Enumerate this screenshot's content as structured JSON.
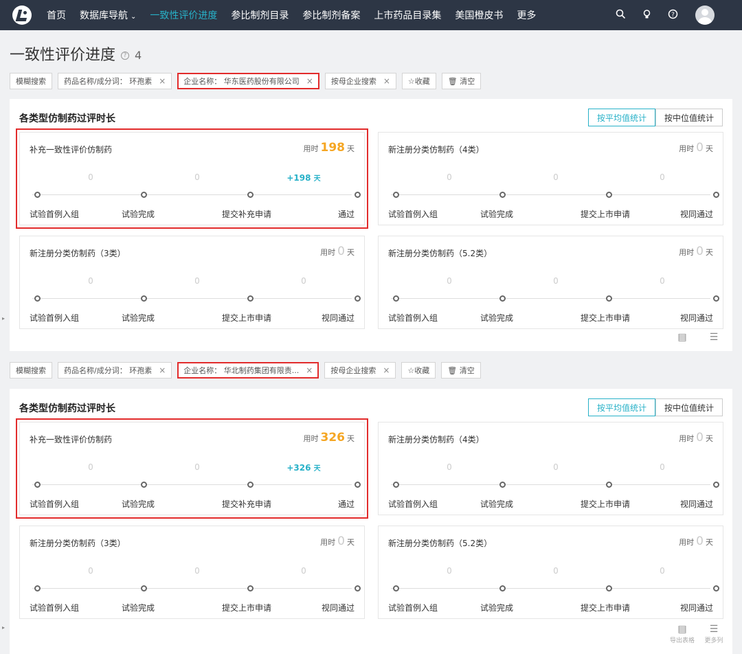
{
  "nav": {
    "items": [
      "首页",
      "数据库导航",
      "一致性评价进度",
      "参比制剂目录",
      "参比制剂备案",
      "上市药品目录集",
      "美国橙皮书",
      "更多"
    ],
    "active": "一致性评价进度",
    "dropdown_caret": "⌄",
    "icons": [
      "search-icon",
      "bulb-icon",
      "help-icon",
      "avatar"
    ]
  },
  "page": {
    "title": "一致性评价进度",
    "help": "?",
    "count": "4"
  },
  "filters": [
    {
      "chips": [
        {
          "label": "模糊搜索",
          "close": false
        },
        {
          "label": "药品名称/成分词： 环孢素",
          "close": true
        },
        {
          "label": "企业名称： 华东医药股份有限公司",
          "close": true,
          "highlight": true
        },
        {
          "label": "按母企业搜索",
          "close": true
        },
        {
          "label": "☆收藏",
          "close": false
        },
        {
          "label": "🗑 清空",
          "close": false
        }
      ]
    },
    {
      "chips": [
        {
          "label": "模糊搜索",
          "close": false
        },
        {
          "label": "药品名称/成分词： 环孢素",
          "close": true
        },
        {
          "label": "企业名称： 华北制药集团有限责...",
          "close": true,
          "highlight": true
        },
        {
          "label": "按母企业搜索",
          "close": true
        },
        {
          "label": "☆收藏",
          "close": false
        },
        {
          "label": "🗑 清空",
          "close": false
        }
      ]
    }
  ],
  "close_glyph": "×",
  "sections": [
    {
      "title": "各类型仿制药过评时长",
      "toggle": [
        "按平均值统计",
        "按中位值统计"
      ],
      "cards": [
        {
          "name": "补充一致性评价仿制药",
          "dur_label": "用时",
          "days": "198",
          "unit": "天",
          "segs": [
            "0",
            "0",
            "+198"
          ],
          "plus_unit": "天",
          "steps": [
            "试验首例入组",
            "试验完成",
            "提交补充申请",
            "通过"
          ],
          "highlight": true
        },
        {
          "name": "新注册分类仿制药（4类）",
          "dur_label": "用时",
          "days": "0",
          "unit": "天",
          "segs": [
            "0",
            "0",
            "0"
          ],
          "steps": [
            "试验首例入组",
            "试验完成",
            "提交上市申请",
            "视同通过"
          ]
        },
        {
          "name": "新注册分类仿制药（3类）",
          "dur_label": "用时",
          "days": "0",
          "unit": "天",
          "segs": [
            "0",
            "0",
            "0"
          ],
          "steps": [
            "试验首例入组",
            "试验完成",
            "提交上市申请",
            "视同通过"
          ]
        },
        {
          "name": "新注册分类仿制药（5.2类）",
          "dur_label": "用时",
          "days": "0",
          "unit": "天",
          "segs": [
            "0",
            "0",
            "0"
          ],
          "steps": [
            "试验首例入组",
            "试验完成",
            "提交上市申请",
            "视同通过"
          ]
        }
      ]
    },
    {
      "title": "各类型仿制药过评时长",
      "toggle": [
        "按平均值统计",
        "按中位值统计"
      ],
      "cards": [
        {
          "name": "补充一致性评价仿制药",
          "dur_label": "用时",
          "days": "326",
          "unit": "天",
          "segs": [
            "0",
            "0",
            "+326"
          ],
          "plus_unit": "天",
          "steps": [
            "试验首例入组",
            "试验完成",
            "提交补充申请",
            "通过"
          ],
          "highlight": true
        },
        {
          "name": "新注册分类仿制药（4类）",
          "dur_label": "用时",
          "days": "0",
          "unit": "天",
          "segs": [
            "0",
            "0",
            "0"
          ],
          "steps": [
            "试验首例入组",
            "试验完成",
            "提交上市申请",
            "视同通过"
          ]
        },
        {
          "name": "新注册分类仿制药（3类）",
          "dur_label": "用时",
          "days": "0",
          "unit": "天",
          "segs": [
            "0",
            "0",
            "0"
          ],
          "steps": [
            "试验首例入组",
            "试验完成",
            "提交上市申请",
            "视同通过"
          ]
        },
        {
          "name": "新注册分类仿制药（5.2类）",
          "dur_label": "用时",
          "days": "0",
          "unit": "天",
          "segs": [
            "0",
            "0",
            "0"
          ],
          "steps": [
            "试验首例入组",
            "试验完成",
            "提交上市申请",
            "视同通过"
          ]
        }
      ]
    }
  ],
  "bottom_actions": [
    {
      "icon": "table-export-icon",
      "glyph": "▤",
      "label": ""
    },
    {
      "icon": "list-columns-icon",
      "glyph": "☰",
      "label": ""
    }
  ],
  "bottom_actions_2": [
    {
      "icon": "table-export-icon",
      "glyph": "▤",
      "label": "导出表格"
    },
    {
      "icon": "list-columns-icon",
      "glyph": "☰",
      "label": "更多列"
    }
  ],
  "side_arrow": "▸",
  "colors": {
    "accent": "#27b1c8",
    "orange": "#f5a623",
    "highlight": "#e22b2b",
    "nav_bg": "#2d3645"
  }
}
